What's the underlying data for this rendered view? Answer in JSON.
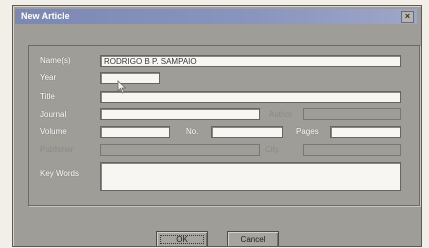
{
  "dialog": {
    "title": "New Article",
    "close_glyph": "×"
  },
  "form": {
    "name_label": "Name(s)",
    "name_value": "RODRIGO B P. SAMPAIO",
    "year_label": "Year",
    "year_value": "",
    "title_label": "Title",
    "title_value": "",
    "journal_label": "Journal",
    "journal_value": "",
    "author_label": "Author",
    "author_value": "",
    "volume_label": "Volume",
    "volume_value": "",
    "no_label": "No.",
    "no_value": "",
    "pages_label": "Pages",
    "pages_value": "",
    "publisher_label": "Publisher",
    "publisher_value": "",
    "city_label": "City",
    "city_value": "",
    "keywords_label": "Key Words",
    "keywords_value": ""
  },
  "buttons": {
    "ok_label": "OK",
    "cancel_label": "Cancel"
  },
  "colors": {
    "titlebar": "#7c88b4",
    "dialog_bg": "#9f9d98",
    "field_bg": "#f7f6f3"
  }
}
